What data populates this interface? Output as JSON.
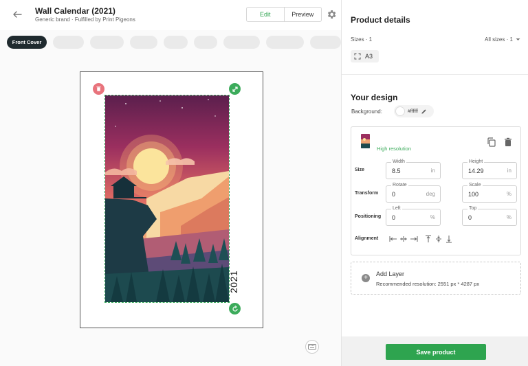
{
  "header": {
    "title": "Wall Calendar (2021)",
    "subtitle": "Generic brand · Fulfilled by Print Pigeons",
    "edit_label": "Edit",
    "preview_label": "Preview"
  },
  "pages": {
    "active_label": "Front Cover"
  },
  "canvas": {
    "year_text": "2021"
  },
  "product_details": {
    "title": "Product details",
    "sizes_label": "Sizes · 1",
    "sizes_select": "All sizes · 1",
    "size_value": "A3"
  },
  "design": {
    "title": "Your design",
    "background_label": "Background:",
    "background_value": "#ffffff",
    "layer": {
      "quality": "High resolution",
      "size_label": "Size",
      "transform_label": "Transform",
      "positioning_label": "Positioning",
      "alignment_label": "Alignment",
      "width": {
        "label": "Width",
        "value": "8.5",
        "unit": "in"
      },
      "height": {
        "label": "Height",
        "value": "14.29",
        "unit": "in"
      },
      "rotate": {
        "label": "Rotate",
        "value": "0",
        "unit": "deg"
      },
      "scale": {
        "label": "Scale",
        "value": "100",
        "unit": "%"
      },
      "left": {
        "label": "Left",
        "value": "0",
        "unit": "%"
      },
      "top": {
        "label": "Top",
        "value": "0",
        "unit": "%"
      }
    },
    "add_layer": {
      "title": "Add Layer",
      "recommendation": "Recommended resolution: 2551 px * 4287 px"
    }
  },
  "footer": {
    "save_label": "Save product"
  },
  "colors": {
    "accent": "#2ea44f",
    "delete": "#e8737c",
    "dark_chip": "#1f2a2e"
  }
}
